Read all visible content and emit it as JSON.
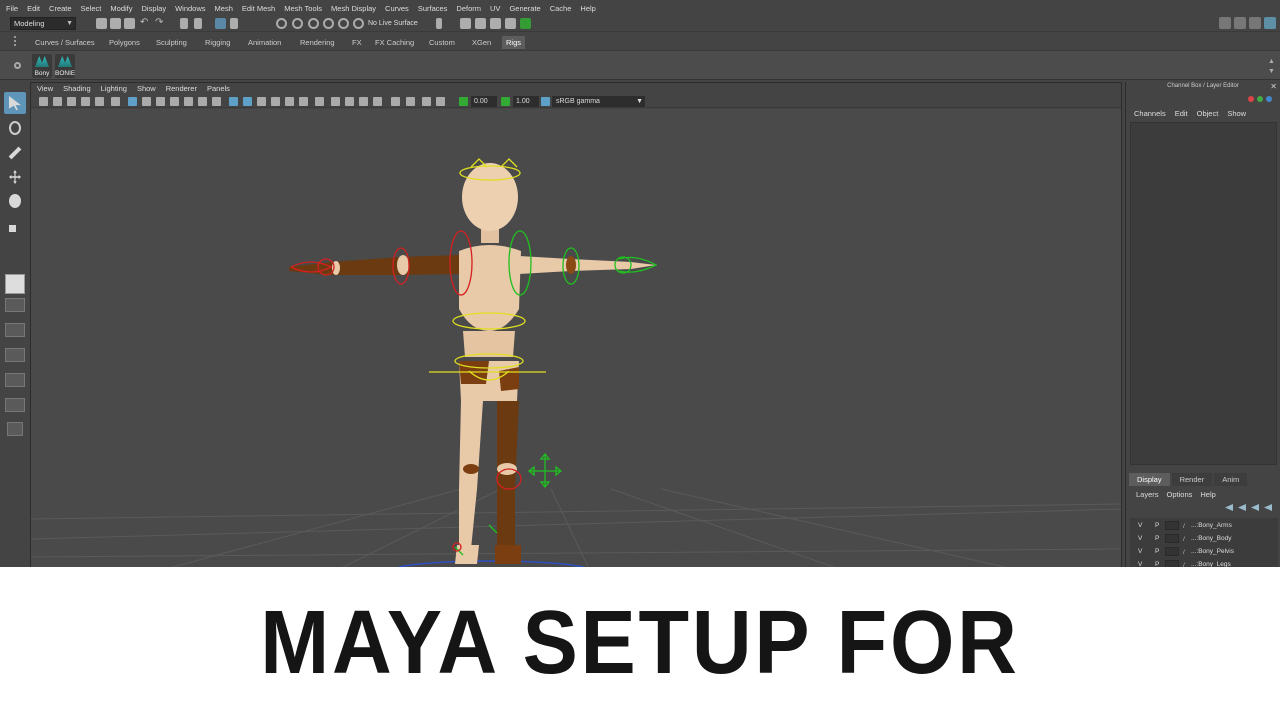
{
  "menubar": {
    "items": [
      "File",
      "Edit",
      "Create",
      "Select",
      "Modify",
      "Display",
      "Windows",
      "Mesh",
      "Edit Mesh",
      "Mesh Tools",
      "Mesh Display",
      "Curves",
      "Surfaces",
      "Deform",
      "UV",
      "Generate",
      "Cache",
      "Help"
    ]
  },
  "statusline": {
    "mode": "Modeling",
    "live_surface": "No Live Surface"
  },
  "shelf": {
    "tabs": [
      "Curves / Surfaces",
      "Polygons",
      "Sculpting",
      "Rigging",
      "Animation",
      "Rendering",
      "FX",
      "FX Caching",
      "Custom",
      "XGen",
      "Rigs"
    ],
    "active_tab": "Rigs",
    "buttons": [
      "Bony",
      "BONIE"
    ]
  },
  "viewport": {
    "menu": [
      "View",
      "Shading",
      "Lighting",
      "Show",
      "Renderer",
      "Panels"
    ],
    "exposure": "0.00",
    "gamma": "1.00",
    "color_space": "sRGB gamma"
  },
  "channel_box": {
    "title": "Channel Box / Layer Editor",
    "menu": [
      "Channels",
      "Edit",
      "Object",
      "Show"
    ]
  },
  "layer_editor": {
    "tabs": [
      "Display",
      "Render",
      "Anim"
    ],
    "active_tab": "Display",
    "menu": [
      "Layers",
      "Options",
      "Help"
    ],
    "layers": [
      {
        "v": "V",
        "p": "P",
        "name": "...:Bony_Arms"
      },
      {
        "v": "V",
        "p": "P",
        "name": "...:Bony_Body"
      },
      {
        "v": "V",
        "p": "P",
        "name": "...:Bony_Pelvis"
      },
      {
        "v": "V",
        "p": "P",
        "name": "...:Bony_Legs"
      }
    ]
  },
  "banner": {
    "title": "MAYA SETUP FOR ANIMATION"
  },
  "colors": {
    "active_blue": "#5e95b9",
    "skin": "#e8c9a8",
    "limb_brown": "#6b3a10",
    "ctrl_red": "#d42020",
    "ctrl_green": "#20c020",
    "ctrl_yellow": "#e0e020"
  }
}
